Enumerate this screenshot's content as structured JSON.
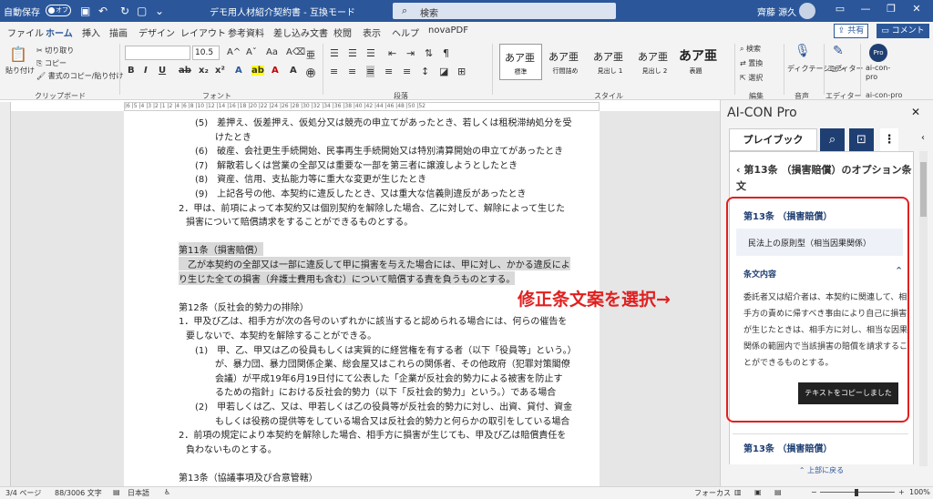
{
  "titlebar": {
    "autosave_label": "自動保存",
    "autosave_state": "オフ",
    "document_title": "デモ用人材紹介契約書 - 互換モード",
    "search_placeholder": "検索",
    "user_name": "齊藤 源久"
  },
  "tabs": [
    "ファイル",
    "ホーム",
    "挿入",
    "描画",
    "デザイン",
    "レイアウト",
    "参考資料",
    "差し込み文書",
    "校閲",
    "表示",
    "ヘルプ",
    "novaPDF"
  ],
  "active_tab": "ホーム",
  "share_label": "共有",
  "comment_label": "コメント",
  "ribbon": {
    "paste_label": "貼り付け",
    "cut_label": "切り取り",
    "copy_label": "コピー",
    "format_painter_label": "書式のコピー/貼り付け",
    "clipboard_group": "クリップボード",
    "font_size": "10.5",
    "font_group": "フォント",
    "paragraph_group": "段落",
    "styles": [
      {
        "preview": "あア亜",
        "name": "標準"
      },
      {
        "preview": "あア亜",
        "name": "行間詰め"
      },
      {
        "preview": "あア亜",
        "name": "見出し 1"
      },
      {
        "preview": "あア亜",
        "name": "見出し 2"
      },
      {
        "preview": "あア亜",
        "name": "表題"
      }
    ],
    "styles_group": "スタイル",
    "find_label": "検索",
    "replace_label": "置換",
    "select_label": "選択",
    "editing_group": "編集",
    "dictate_label": "ディクテーション",
    "voice_group": "音声",
    "editor_label": "エディター",
    "editor_group": "エディター",
    "aicon_label": "ai-con-pro",
    "aicon_group": "ai-con-pro",
    "aicon_badge": "Pro"
  },
  "document": {
    "lines": [
      {
        "text": "(5)　差押え、仮差押え、仮処分又は競売の申立てがあったとき、若しくは租税滞納処分を受",
        "indent": 2
      },
      {
        "text": "けたとき",
        "indent": 3
      },
      {
        "text": "(6)　破産、会社更生手続開始、民事再生手続開始又は特別清算開始の申立てがあったとき",
        "indent": 2
      },
      {
        "text": "(7)　解散若しくは営業の全部又は重要な一部を第三者に譲渡しようとしたとき",
        "indent": 2
      },
      {
        "text": "(8)　資産、信用、支払能力等に重大な変更が生じたとき",
        "indent": 2
      },
      {
        "text": "(9)　上記各号の他、本契約に違反したとき、又は重大な信義則違反があったとき",
        "indent": 2
      },
      {
        "text": "2．甲は、前項によって本契約又は個別契約を解除した場合、乙に対して、解除によって生じた",
        "indent": 0
      },
      {
        "text": "損害について賠償請求をすることができるものとする。",
        "indent": 1
      },
      {
        "text": "",
        "indent": 0
      },
      {
        "text": "第11条（損害賠償）",
        "indent": 0,
        "highlight": true
      },
      {
        "text": "　乙が本契約の全部又は一部に違反して甲に損害を与えた場合には、甲に対し、かかる違反によ",
        "indent": 0,
        "highlight": true
      },
      {
        "text": "り生じた全ての損害（弁護士費用も含む）について賠償する責を負うものとする。",
        "indent": 0,
        "highlight": true
      },
      {
        "text": "",
        "indent": 0
      },
      {
        "text": "第12条（反社会的勢力の排除）",
        "indent": 0
      },
      {
        "text": "1．甲及び乙は、相手方が次の各号のいずれかに該当すると認められる場合には、何らの催告を",
        "indent": 0
      },
      {
        "text": "要しないで、本契約を解除することができる。",
        "indent": 1
      },
      {
        "text": "(1)　甲、乙、甲又は乙の役員もしくは実質的に経営権を有する者（以下「役員等」という。）",
        "indent": 2
      },
      {
        "text": "が、暴力団、暴力団関係企業、総会屋又はこれらの関係者、その他政府（犯罪対策閣僚",
        "indent": 3
      },
      {
        "text": "会議）が平成19年6月19日付にて公表した「企業が反社会的勢力による被害を防止す",
        "indent": 3
      },
      {
        "text": "るための指針」における反社会的勢力（以下「反社会的勢力」という。）である場合",
        "indent": 3
      },
      {
        "text": "(2)　甲若しくは乙、又は、甲若しくは乙の役員等が反社会的勢力に対し、出資、貸付、資金",
        "indent": 2
      },
      {
        "text": "もしくは役務の提供等をしている場合又は反社会的勢力と何らかの取引をしている場合",
        "indent": 3
      },
      {
        "text": "2．前項の規定により本契約を解除した場合、相手方に損害が生じても、甲及び乙は賠償責任を",
        "indent": 0
      },
      {
        "text": "負わないものとする。",
        "indent": 1
      },
      {
        "text": "",
        "indent": 0
      },
      {
        "text": "第13条（協議事項及び合意管轄）",
        "indent": 0
      }
    ]
  },
  "annotation": "修正条文案を選択→",
  "pane": {
    "title": "AI-CON Pro",
    "tab_label": "プレイブック",
    "back_text": "第13条 （損害賠償）のオプション条文",
    "card_title": "第13条 （損害賠償）",
    "option_text": "民法上の原則型（相当因果関係）",
    "section_title": "条文内容",
    "section_body": "委託者又は紹介者は、本契約に関連して、相手方の責めに帰すべき事由により自己に損害が生じたときは、相手方に対し、相当な因果関係の範囲内で当該損害の賠償を請求することができるものとする。",
    "toast": "テキストをコピーしました",
    "next_card_title": "第13条 （損害賠償）",
    "back_to_top": "上部に戻る"
  },
  "statusbar": {
    "page": "3/4 ページ",
    "words": "88/3006 文字",
    "language": "日本語",
    "focus": "フォーカス",
    "zoom": "100%"
  }
}
